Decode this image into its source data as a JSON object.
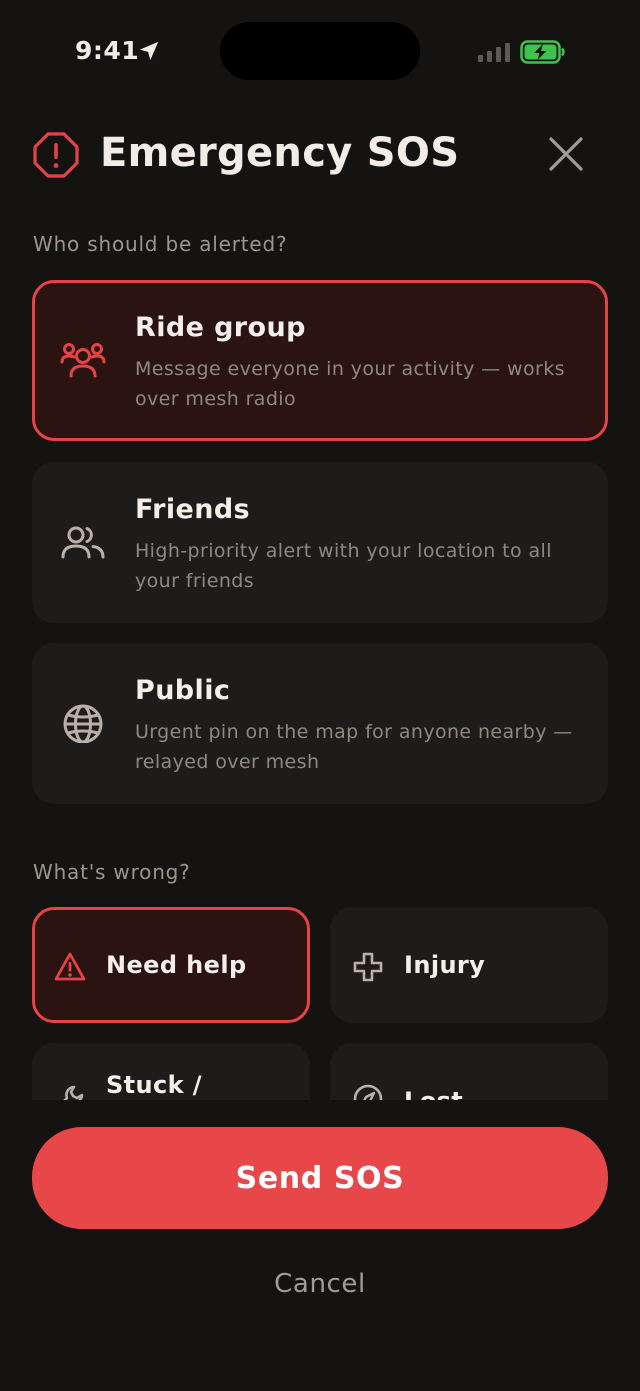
{
  "status_bar": {
    "time": "9:41",
    "location_icon": "location-arrow-icon",
    "signal_icon": "cellular-signal-icon",
    "battery_icon": "battery-charging-icon",
    "battery_color": "#3ec34e"
  },
  "header": {
    "icon": "alert-octagon-icon",
    "title": "Emergency SOS",
    "close_icon": "close-icon"
  },
  "recipients": {
    "label": "Who should be alerted?",
    "options": [
      {
        "icon": "group-icon",
        "title": "Ride group",
        "description": "Message everyone in your activity — works over mesh radio",
        "selected": true
      },
      {
        "icon": "friends-icon",
        "title": "Friends",
        "description": "High-priority alert with your location to all your friends",
        "selected": false
      },
      {
        "icon": "globe-icon",
        "title": "Public",
        "description": "Urgent pin on the map for anyone nearby — relayed over mesh",
        "selected": false
      }
    ]
  },
  "problem": {
    "label": "What's wrong?",
    "options": [
      {
        "icon": "warning-triangle-icon",
        "label": "Need help",
        "selected": true
      },
      {
        "icon": "medical-cross-icon",
        "label": "Injury",
        "selected": false
      },
      {
        "icon": "wrench-icon",
        "label": "Stuck /",
        "selected": false
      },
      {
        "icon": "compass-icon",
        "label": "Lost",
        "selected": false
      }
    ]
  },
  "actions": {
    "send_label": "Send SOS",
    "cancel_label": "Cancel"
  },
  "colors": {
    "background": "#151312",
    "card": "#1e1c1b",
    "accent": "#e54346",
    "selected_card": "#2a1311",
    "muted_text": "#9c958e"
  }
}
